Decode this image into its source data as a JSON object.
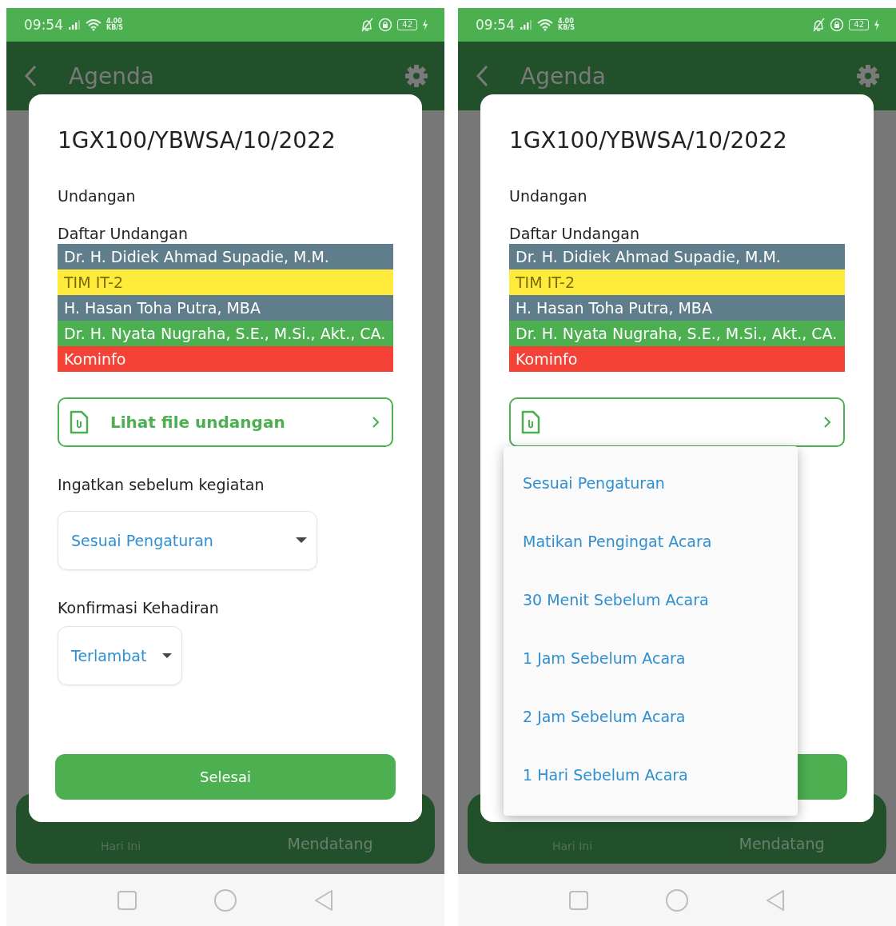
{
  "screens": [
    {
      "status_bar": {
        "time": "09:54",
        "speed_value": "4.00",
        "speed_unit": "KB/S",
        "battery": "42"
      },
      "app_bar": {
        "title": "Agenda"
      },
      "bottom_nav": [
        {
          "label": "Hari Ini",
          "selected": false
        },
        {
          "label": "Mendatang",
          "selected": true
        }
      ],
      "dialog": {
        "title": "1GX100/YBWSA/10/2022",
        "type_label": "Undangan",
        "list_label": "Daftar Undangan",
        "invitees": [
          {
            "name": "Dr. H. Didiek Ahmad Supadie, M.M.",
            "color": "#607d8b"
          },
          {
            "name": "TIM IT-2",
            "color": "#ffeb3b"
          },
          {
            "name": "H. Hasan Toha Putra, MBA",
            "color": "#607d8b"
          },
          {
            "name": "Dr. H. Nyata Nugraha, S.E., M.Si., Akt., CA.",
            "color": "#4caf50"
          },
          {
            "name": "Kominfo",
            "color": "#f44336"
          }
        ],
        "file_button": {
          "label": "Lihat file undangan"
        },
        "reminder": {
          "label": "Ingatkan sebelum kegiatan",
          "value": "Sesuai Pengaturan"
        },
        "attendance": {
          "label": "Konfirmasi Kehadiran",
          "value": "Terlambat"
        },
        "done_button": {
          "label": "Selesai"
        }
      }
    },
    {
      "status_bar": {
        "time": "09:54",
        "speed_value": "4.00",
        "speed_unit": "KB/S",
        "battery": "42"
      },
      "app_bar": {
        "title": "Agenda"
      },
      "bottom_nav": [
        {
          "label": "Hari Ini",
          "selected": false
        },
        {
          "label": "Mendatang",
          "selected": true
        }
      ],
      "dialog": {
        "title": "1GX100/YBWSA/10/2022",
        "type_label": "Undangan",
        "list_label": "Daftar Undangan",
        "invitees": [
          {
            "name": "Dr. H. Didiek Ahmad Supadie, M.M.",
            "color": "#607d8b"
          },
          {
            "name": "TIM IT-2",
            "color": "#ffeb3b"
          },
          {
            "name": "H. Hasan Toha Putra, MBA",
            "color": "#607d8b"
          },
          {
            "name": "Dr. H. Nyata Nugraha, S.E., M.Si., Akt., CA.",
            "color": "#4caf50"
          },
          {
            "name": "Kominfo",
            "color": "#f44336"
          }
        ]
      },
      "dropdown_menu": {
        "items": [
          "Sesuai Pengaturan",
          "Matikan Pengingat Acara",
          "30 Menit Sebelum Acara",
          "1 Jam Sebelum Acara",
          "2 Jam Sebelum Acara",
          "1 Hari Sebelum Acara"
        ]
      }
    }
  ]
}
